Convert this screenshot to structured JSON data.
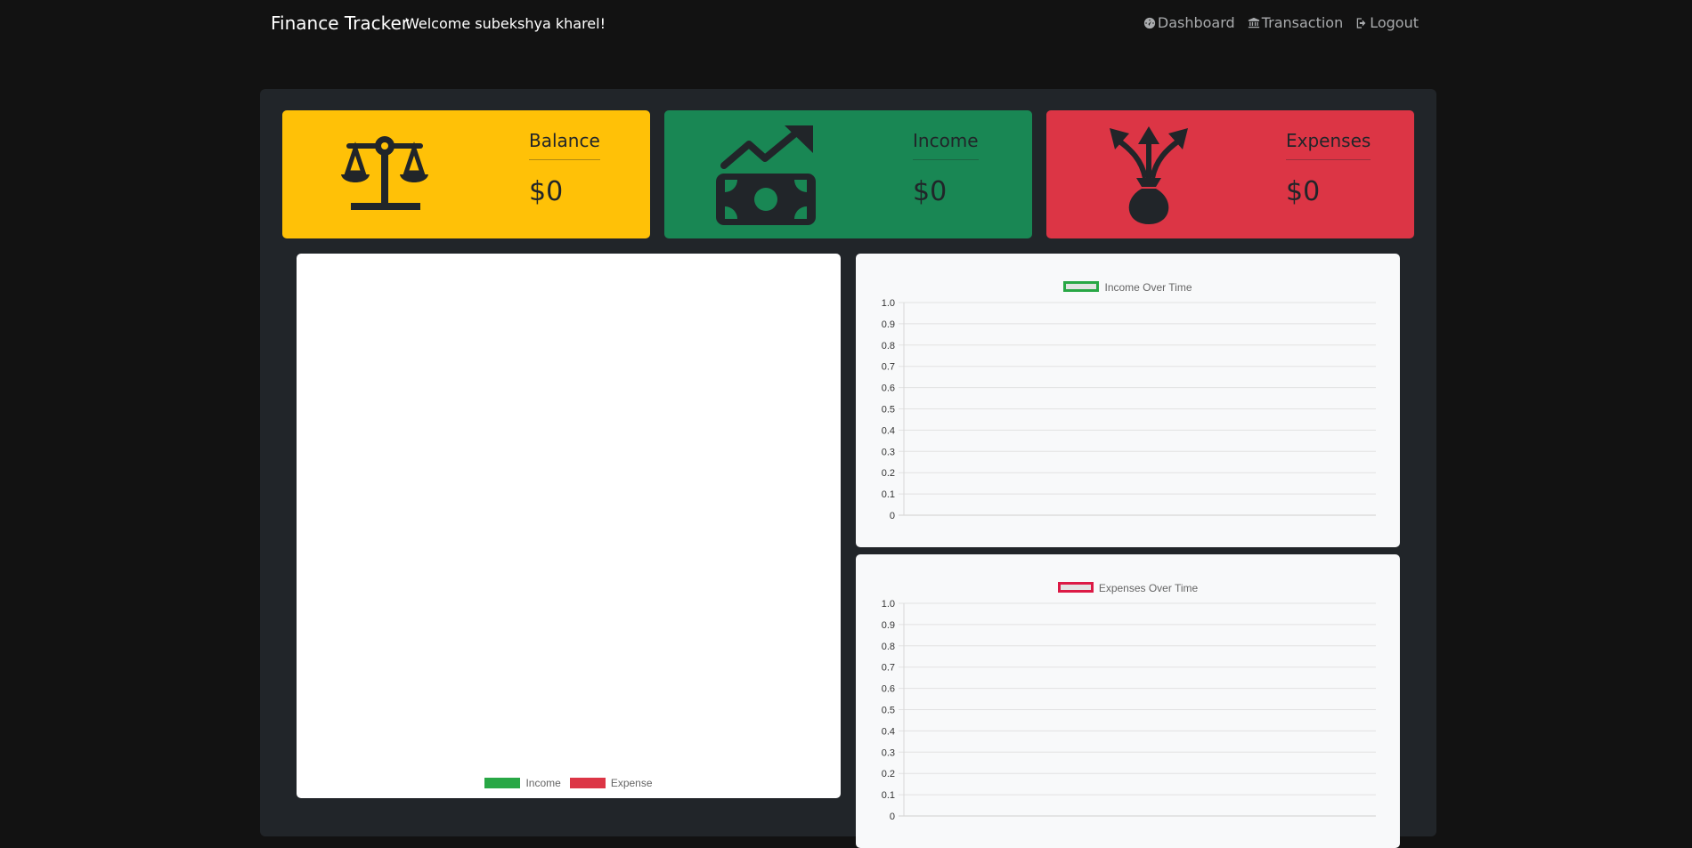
{
  "nav": {
    "brand": "Finance Tracker",
    "welcome": "Welcome subekshya kharel!",
    "links": [
      {
        "label": "Dashboard",
        "icon": "speedometer-icon"
      },
      {
        "label": "Transaction",
        "icon": "bank-icon"
      },
      {
        "label": "Logout",
        "icon": "logout-icon"
      }
    ]
  },
  "cards": {
    "balance": {
      "label": "Balance",
      "amount": "$0",
      "icon": "scale-icon",
      "color": "#ffc107"
    },
    "income": {
      "label": "Income",
      "amount": "$0",
      "icon": "cash-trend-up-icon",
      "color": "#198754"
    },
    "expenses": {
      "label": "Expenses",
      "amount": "$0",
      "icon": "money-bag-arrows-icon",
      "color": "#dc3545"
    }
  },
  "colors": {
    "income": "#28a745",
    "expense": "#dc3545",
    "expense_line": "#dc1a45"
  },
  "chart_data": [
    {
      "type": "bar",
      "series": [
        {
          "name": "Income",
          "values": []
        },
        {
          "name": "Expense",
          "values": []
        }
      ],
      "categories": [],
      "legend": "bottom"
    },
    {
      "type": "line",
      "series": [
        {
          "name": "Income Over Time",
          "values": []
        }
      ],
      "x": [],
      "ylim": [
        0,
        1.0
      ],
      "yticks": [
        "1.0",
        "0.9",
        "0.8",
        "0.7",
        "0.6",
        "0.5",
        "0.4",
        "0.3",
        "0.2",
        "0.1",
        "0"
      ],
      "grid": true,
      "legend": "top"
    },
    {
      "type": "line",
      "series": [
        {
          "name": "Expenses Over Time",
          "values": []
        }
      ],
      "x": [],
      "ylim": [
        0,
        1.0
      ],
      "yticks": [
        "1.0",
        "0.9",
        "0.8",
        "0.7",
        "0.6",
        "0.5",
        "0.4",
        "0.3",
        "0.2",
        "0.1",
        "0"
      ],
      "grid": true,
      "legend": "top"
    }
  ]
}
